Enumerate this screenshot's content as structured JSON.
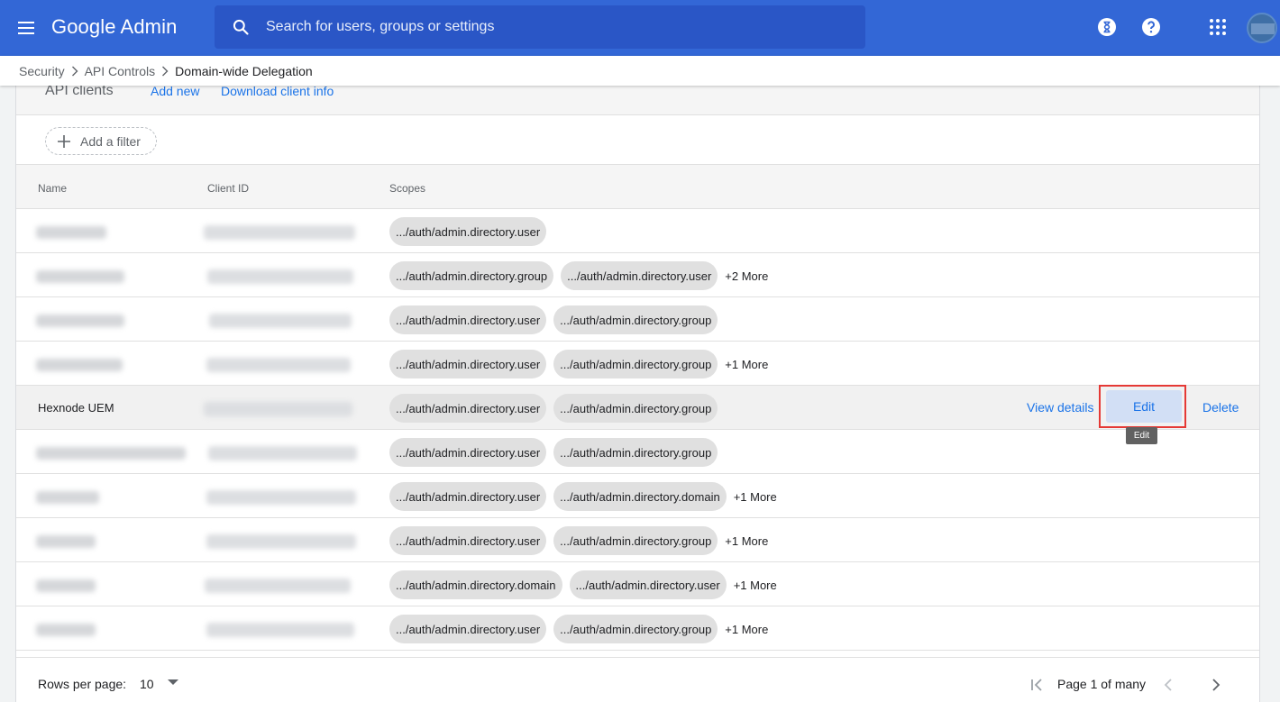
{
  "app": {
    "brand": "Google Admin"
  },
  "search": {
    "placeholder": "Search for users, groups or settings"
  },
  "topbar_icons": [
    "menu-icon",
    "search-icon",
    "hourglass-icon",
    "help-icon",
    "apps-grid-icon",
    "avatar"
  ],
  "breadcrumb": [
    "Security",
    "API Controls",
    "Domain-wide Delegation"
  ],
  "panel": {
    "title": "API clients",
    "add_new": "Add new",
    "download": "Download client info",
    "add_filter": "Add a filter"
  },
  "columns": {
    "name": "Name",
    "client_id": "Client ID",
    "scopes": "Scopes"
  },
  "rows": [
    {
      "name": "",
      "scopes": [
        ".../auth/admin.directory.user"
      ],
      "more": ""
    },
    {
      "name": "",
      "scopes": [
        ".../auth/admin.directory.group",
        ".../auth/admin.directory.user"
      ],
      "more": "+2 More"
    },
    {
      "name": "",
      "scopes": [
        ".../auth/admin.directory.user",
        ".../auth/admin.directory.group"
      ],
      "more": ""
    },
    {
      "name": "",
      "scopes": [
        ".../auth/admin.directory.user",
        ".../auth/admin.directory.group"
      ],
      "more": "+1 More"
    },
    {
      "name": "Hexnode UEM",
      "scopes": [
        ".../auth/admin.directory.user",
        ".../auth/admin.directory.group"
      ],
      "more": ""
    },
    {
      "name": "",
      "scopes": [
        ".../auth/admin.directory.user",
        ".../auth/admin.directory.group"
      ],
      "more": ""
    },
    {
      "name": "",
      "scopes": [
        ".../auth/admin.directory.user",
        ".../auth/admin.directory.domain"
      ],
      "more": "+1 More"
    },
    {
      "name": "",
      "scopes": [
        ".../auth/admin.directory.user",
        ".../auth/admin.directory.group"
      ],
      "more": "+1 More"
    },
    {
      "name": "",
      "scopes": [
        ".../auth/admin.directory.domain",
        ".../auth/admin.directory.user"
      ],
      "more": "+1 More"
    },
    {
      "name": "",
      "scopes": [
        ".../auth/admin.directory.user",
        ".../auth/admin.directory.group"
      ],
      "more": "+1 More"
    }
  ],
  "row_actions": {
    "view_details": "View details",
    "edit": "Edit",
    "delete": "Delete",
    "tooltip": "Edit"
  },
  "footer": {
    "rows_per_page_label": "Rows per page:",
    "rows_per_page_value": "10",
    "page_label": "Page 1 of many"
  },
  "colors": {
    "appbar": "#3367d6",
    "link": "#1a73e8",
    "highlight": "#e53935"
  }
}
